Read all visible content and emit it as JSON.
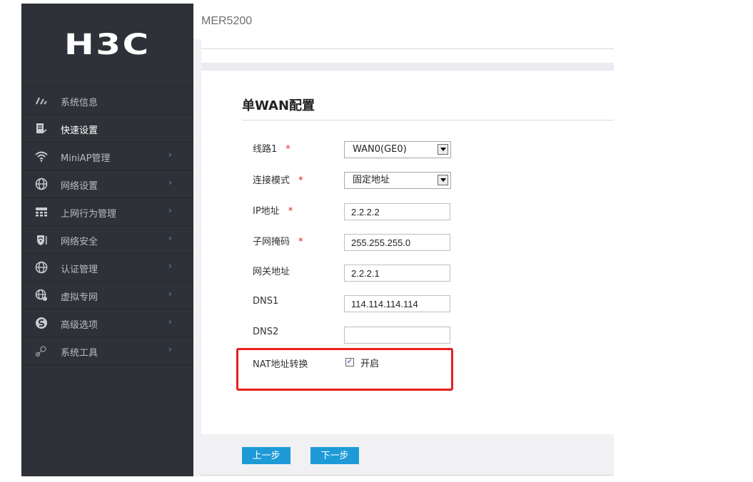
{
  "app": {
    "logo": "H3C",
    "device": "MER5200"
  },
  "colors": {
    "sidebar_bg": "#2e3137",
    "accent_button": "#1e9bd7",
    "required_star": "#e02020",
    "highlight_box": "#e8201d"
  },
  "sidebar": {
    "items": [
      {
        "label": "系统信息",
        "icon": "gauge-icon",
        "arrow": ""
      },
      {
        "label": "快速设置",
        "icon": "clipboard-icon",
        "arrow": "",
        "active": true
      },
      {
        "label": "MiniAP管理",
        "icon": "wifi-icon",
        "arrow": "›"
      },
      {
        "label": "网络设置",
        "icon": "globe-icon",
        "arrow": "›"
      },
      {
        "label": "上网行为管理",
        "icon": "network-behavior-icon",
        "arrow": "›"
      },
      {
        "label": "网络安全",
        "icon": "shield-icon",
        "arrow": "›"
      },
      {
        "label": "认证管理",
        "icon": "globe-icon",
        "arrow": "›"
      },
      {
        "label": "虚拟专网",
        "icon": "vpn-globe-icon",
        "arrow": "›"
      },
      {
        "label": "高级选项",
        "icon": "advanced-icon",
        "arrow": "›"
      },
      {
        "label": "系统工具",
        "icon": "tools-icon",
        "arrow": "›"
      }
    ]
  },
  "panel": {
    "title": "单WAN配置",
    "required_mark": "*",
    "fields": {
      "line": {
        "label": "线路1",
        "value": "WAN0(GE0)"
      },
      "mode": {
        "label": "连接模式",
        "value": "固定地址"
      },
      "ip": {
        "label": "IP地址",
        "value": "2.2.2.2"
      },
      "mask": {
        "label": "子网掩码",
        "value": "255.255.255.0"
      },
      "gateway": {
        "label": "网关地址",
        "value": "2.2.2.1"
      },
      "dns1": {
        "label": "DNS1",
        "value": "114.114.114.114"
      },
      "dns2": {
        "label": "DNS2",
        "value": ""
      }
    },
    "nat": {
      "label": "NAT地址转换",
      "checked": true,
      "check_mark": "✓",
      "option_label": "开启"
    }
  },
  "footer": {
    "prev_label": "上一步",
    "next_label": "下一步"
  }
}
